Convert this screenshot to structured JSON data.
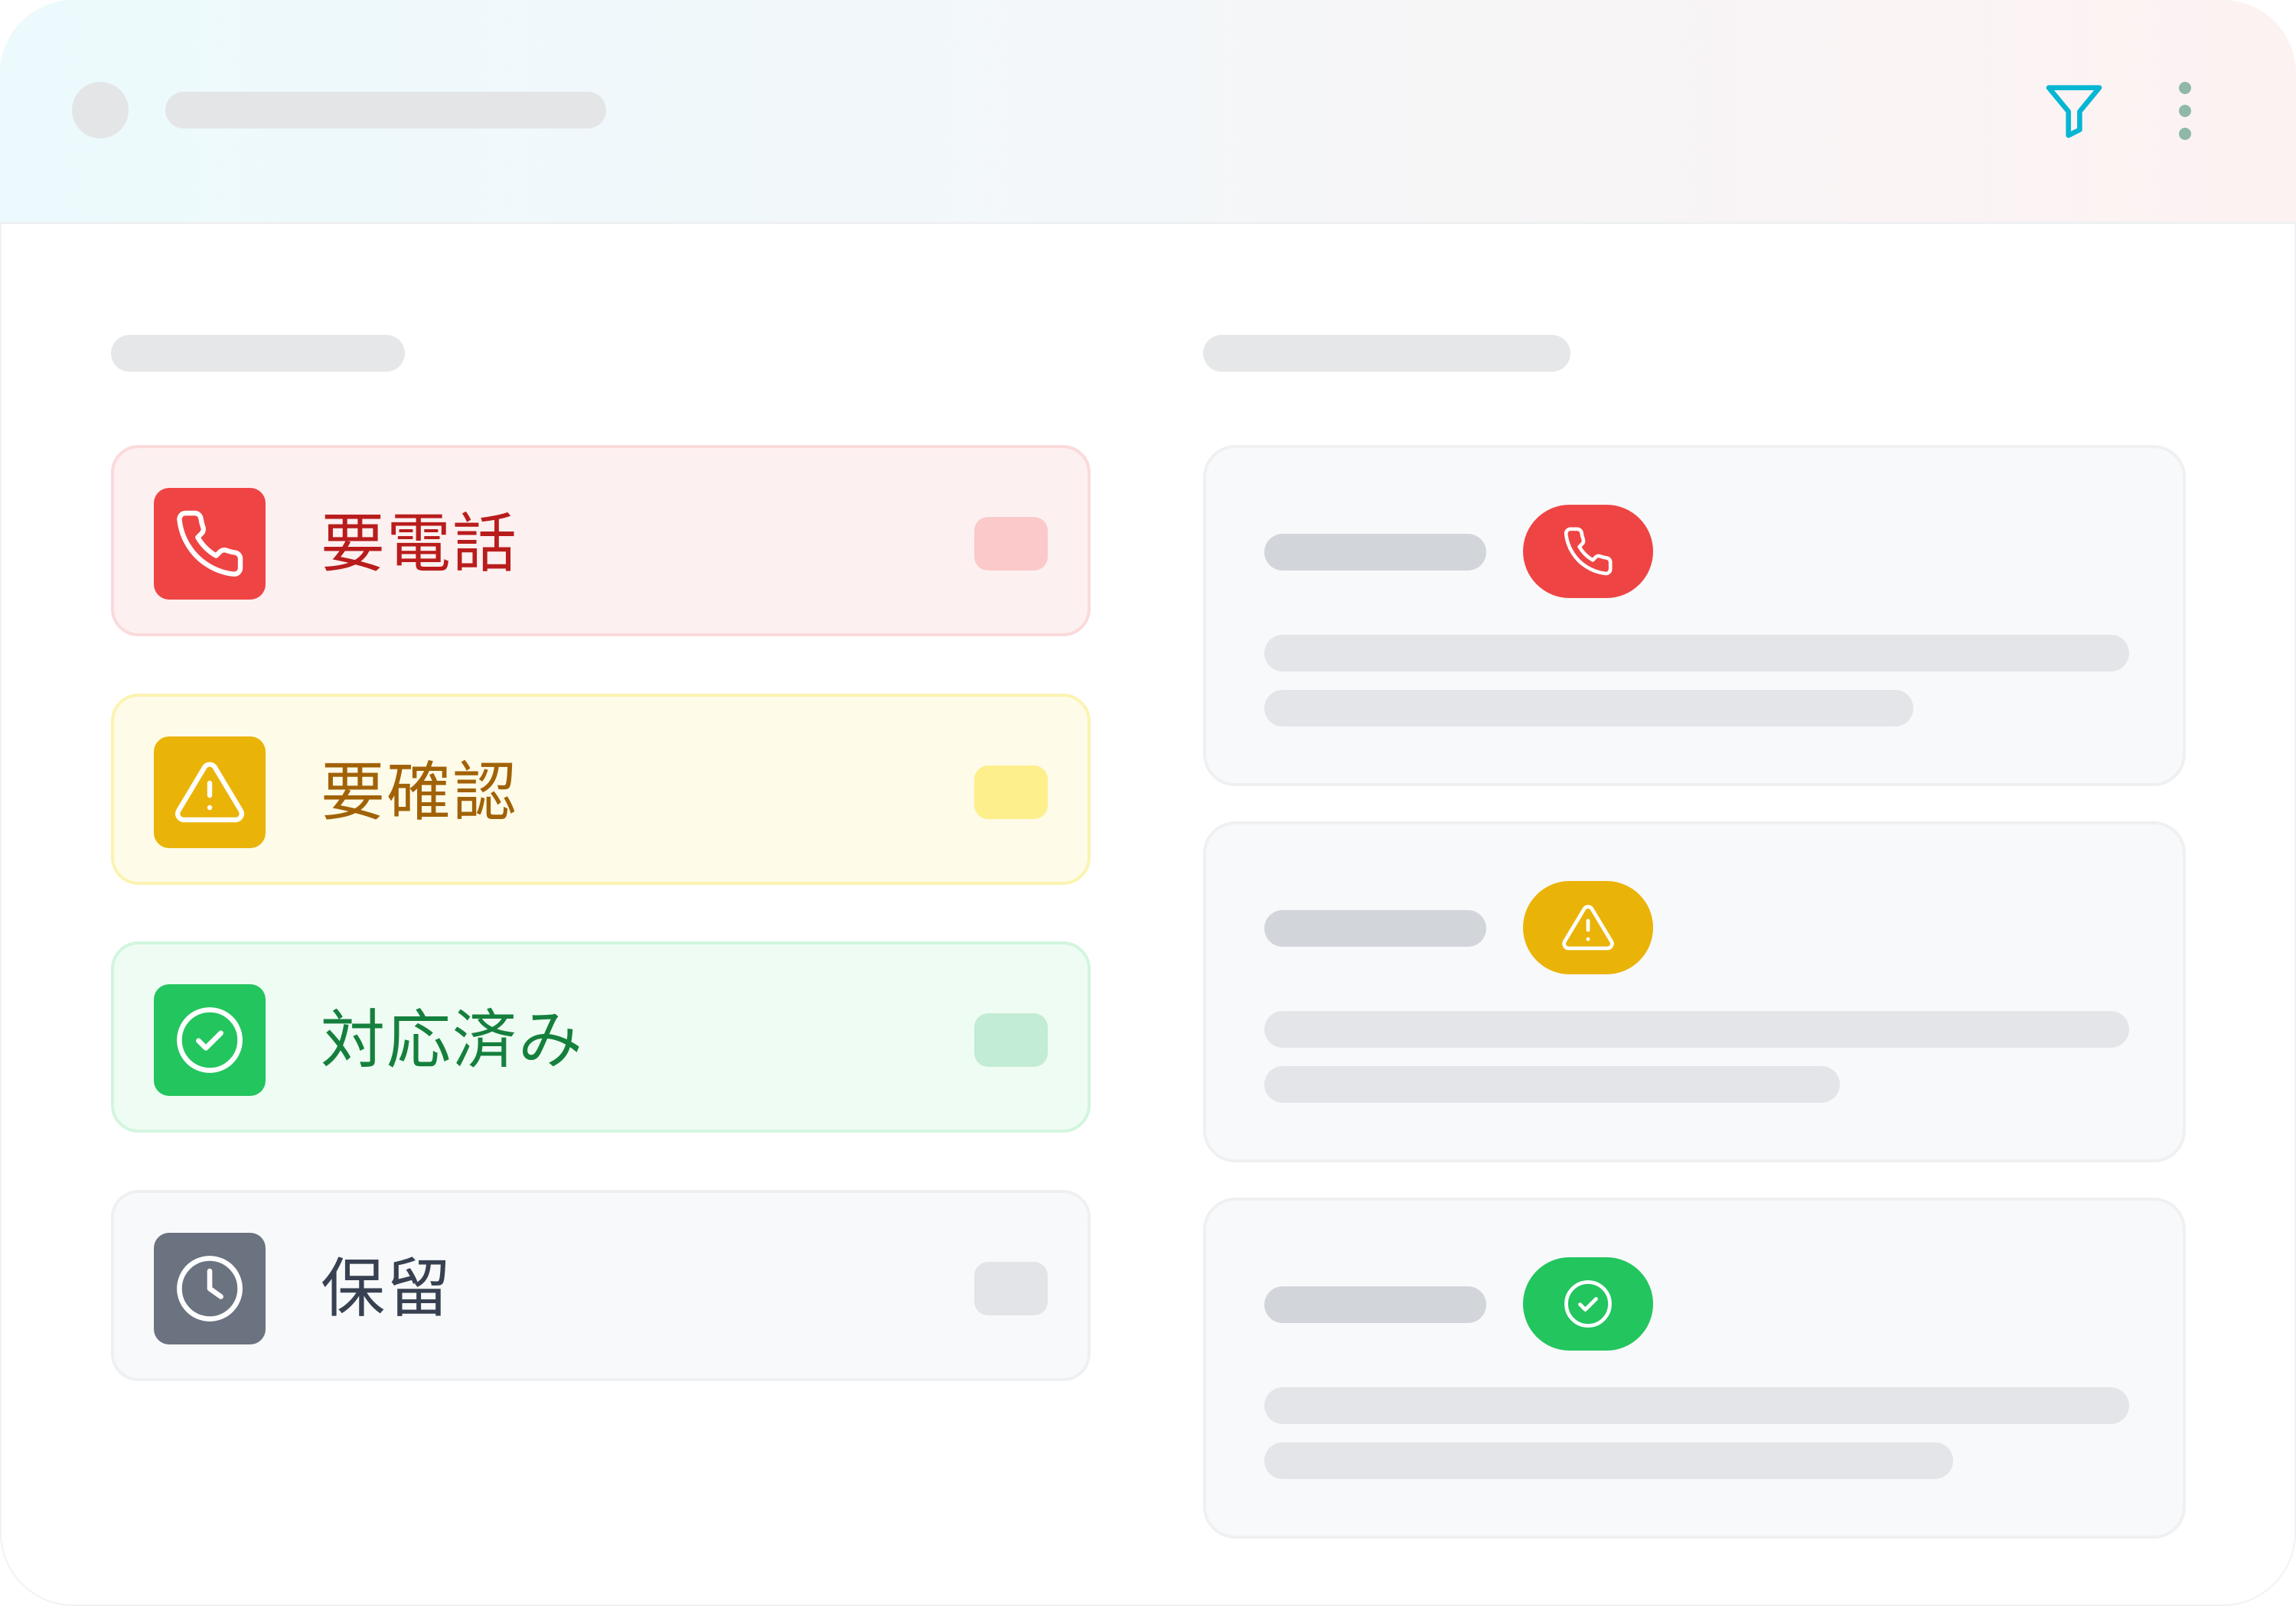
{
  "header": {
    "filter_icon": "filter-icon",
    "more_icon": "more-vertical-icon"
  },
  "status_list": [
    {
      "label": "要電話",
      "icon": "phone-icon",
      "color": "#ef4444",
      "text_color": "#b91c1c"
    },
    {
      "label": "要確認",
      "icon": "alert-triangle-icon",
      "color": "#eab308",
      "text_color": "#a16207"
    },
    {
      "label": "対応済み",
      "icon": "check-circle-icon",
      "color": "#22c55e",
      "text_color": "#15803d"
    },
    {
      "label": "保留",
      "icon": "clock-icon",
      "color": "#6b7280",
      "text_color": "#374151"
    }
  ],
  "cards": [
    {
      "badge_icon": "phone-icon",
      "badge_color": "#ef4444"
    },
    {
      "badge_icon": "alert-triangle-icon",
      "badge_color": "#eab308"
    },
    {
      "badge_icon": "check-circle-icon",
      "badge_color": "#22c55e"
    }
  ],
  "colors": {
    "accent_filter": "#06b6d4",
    "more_dots": "#8fb8a8"
  }
}
